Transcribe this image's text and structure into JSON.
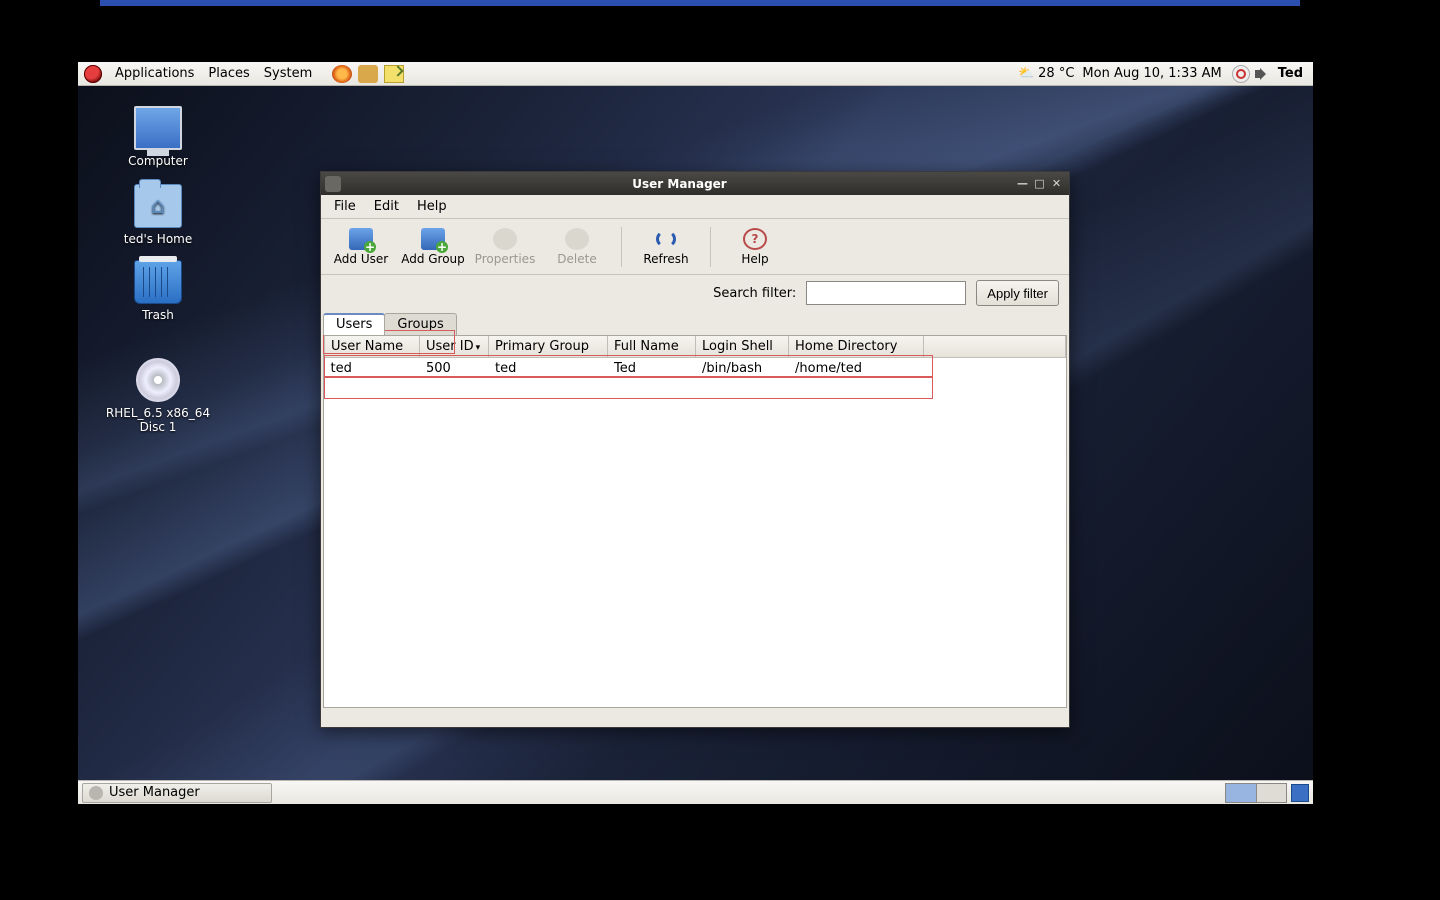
{
  "top_panel": {
    "menus": [
      "Applications",
      "Places",
      "System"
    ],
    "weather_temp": "28 °C",
    "clock": "Mon Aug 10,  1:33 AM",
    "user": "Ted"
  },
  "desktop_icons": {
    "computer": "Computer",
    "home": "ted's Home",
    "trash": "Trash",
    "disc": "RHEL_6.5 x86_64\nDisc 1"
  },
  "taskbar": {
    "task_label": "User Manager"
  },
  "window": {
    "title": "User Manager",
    "menus": [
      "File",
      "Edit",
      "Help"
    ],
    "toolbar": {
      "add_user": "Add User",
      "add_group": "Add Group",
      "properties": "Properties",
      "delete": "Delete",
      "refresh": "Refresh",
      "help": "Help"
    },
    "filter_label": "Search filter:",
    "filter_value": "",
    "apply_filter": "Apply filter",
    "tabs": {
      "users": "Users",
      "groups": "Groups"
    },
    "columns": {
      "user_name": "User Name",
      "user_id": "User ID",
      "primary_group": "Primary Group",
      "full_name": "Full Name",
      "login_shell": "Login Shell",
      "home_directory": "Home Directory"
    },
    "rows": [
      {
        "user_name": "ted",
        "user_id": "500",
        "primary_group": "ted",
        "full_name": "Ted",
        "login_shell": "/bin/bash",
        "home_directory": "/home/ted"
      }
    ]
  }
}
